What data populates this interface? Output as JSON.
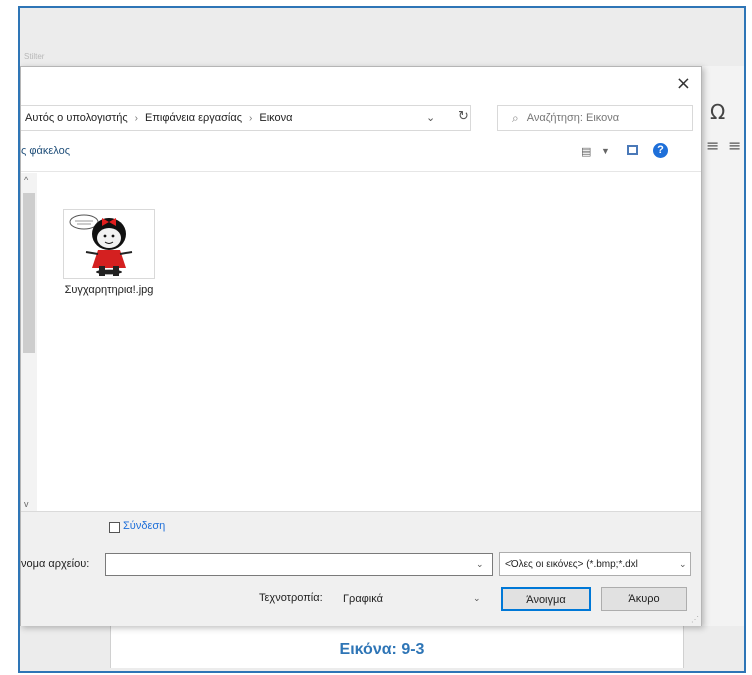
{
  "background": {
    "faint_label": "Stilter",
    "omega_symbol": "Ω",
    "align_icons": [
      "≡",
      "≡"
    ]
  },
  "dialog": {
    "close_glyph": "×",
    "breadcrumb": [
      "Αυτός ο υπολογιστής",
      "Επιφάνεια εργασίας",
      "Εικονα"
    ],
    "breadcrumb_separator": "›",
    "search_placeholder": "Αναζήτηση: Εικονα",
    "new_folder_label": "ς φάκελος",
    "help_glyph": "?",
    "file": {
      "name": "Συγχαρητηρια!.jpg",
      "thumbnail": "mafalda-cartoon-image"
    },
    "link_checkbox_label": "Σύνδεση",
    "file_name_label": "νομα αρχείου:",
    "file_name_value": "",
    "file_type_value": "<Όλες οι εικόνες> (*.bmp;*.dxl",
    "tools_label": "Τεχνοτροπία:",
    "tools_value": "Γραφικά",
    "open_button": "Άνοιγμα",
    "cancel_button": "Άκυρο"
  },
  "caption": "Εικόνα: 9-3",
  "colors": {
    "frame_border": "#2e75b6",
    "caption": "#2e75b6",
    "link": "#1e6fd9",
    "primary_button_border": "#0078d7"
  }
}
